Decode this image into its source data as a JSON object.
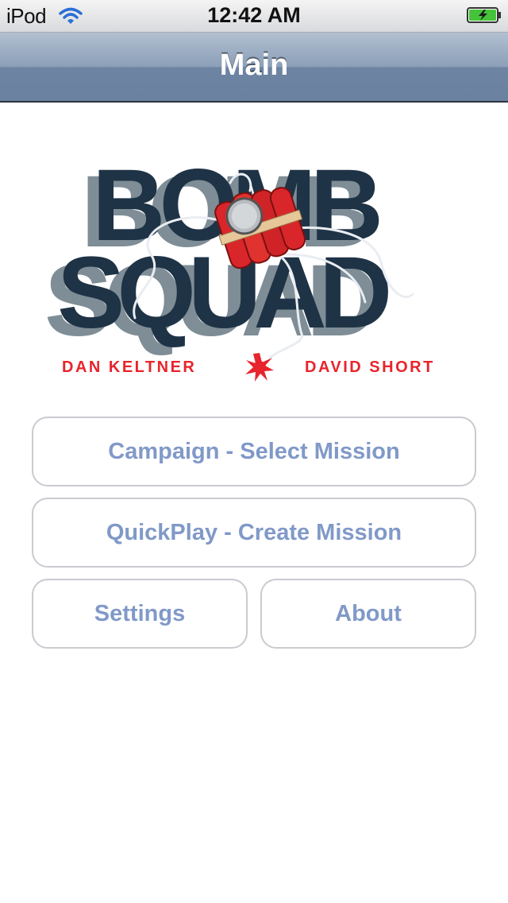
{
  "status_bar": {
    "carrier": "iPod",
    "time": "12:42 AM",
    "wifi_icon": "wifi-icon",
    "battery_icon": "battery-charging-icon"
  },
  "nav_bar": {
    "title": "Main"
  },
  "logo": {
    "title_line1": "BOMB",
    "title_line2": "SQUAD",
    "credit_left": "DAN KELTNER",
    "credit_right": "DAVID SHORT"
  },
  "menu": {
    "campaign_label": "Campaign - Select Mission",
    "quickplay_label": "QuickPlay - Create Mission",
    "settings_label": "Settings",
    "about_label": "About"
  },
  "colors": {
    "nav_bar": "#7f93ae",
    "button_text": "#8099c8",
    "logo_letters": "#1f3346",
    "logo_shadow": "#7e8d96",
    "dynamite": "#d9262b",
    "credit_text": "#e8242c"
  }
}
